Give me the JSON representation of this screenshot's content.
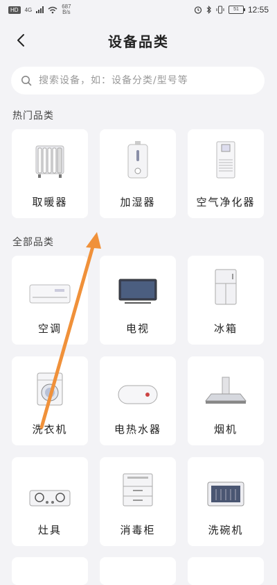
{
  "status": {
    "hd": "HD",
    "signal": "4G",
    "speed_value": "687",
    "speed_unit": "B/s",
    "battery": "51",
    "time": "12:55"
  },
  "header": {
    "title": "设备品类"
  },
  "search": {
    "placeholder": "搜索设备，如：设备分类/型号等"
  },
  "hot": {
    "title": "热门品类",
    "items": [
      {
        "label": "取暖器",
        "icon": "heater-icon"
      },
      {
        "label": "加湿器",
        "icon": "humidifier-icon"
      },
      {
        "label": "空气净化器",
        "icon": "air-purifier-icon"
      }
    ]
  },
  "all": {
    "title": "全部品类",
    "items": [
      {
        "label": "空调",
        "icon": "air-conditioner-icon"
      },
      {
        "label": "电视",
        "icon": "tv-icon"
      },
      {
        "label": "冰箱",
        "icon": "fridge-icon"
      },
      {
        "label": "洗衣机",
        "icon": "washing-machine-icon"
      },
      {
        "label": "电热水器",
        "icon": "water-heater-icon"
      },
      {
        "label": "烟机",
        "icon": "range-hood-icon"
      },
      {
        "label": "灶具",
        "icon": "stove-icon"
      },
      {
        "label": "消毒柜",
        "icon": "disinfection-cabinet-icon"
      },
      {
        "label": "洗碗机",
        "icon": "dishwasher-icon"
      }
    ]
  },
  "colors": {
    "accent": "#f0913a",
    "background": "#f3f3f6",
    "tile": "#ffffff"
  }
}
